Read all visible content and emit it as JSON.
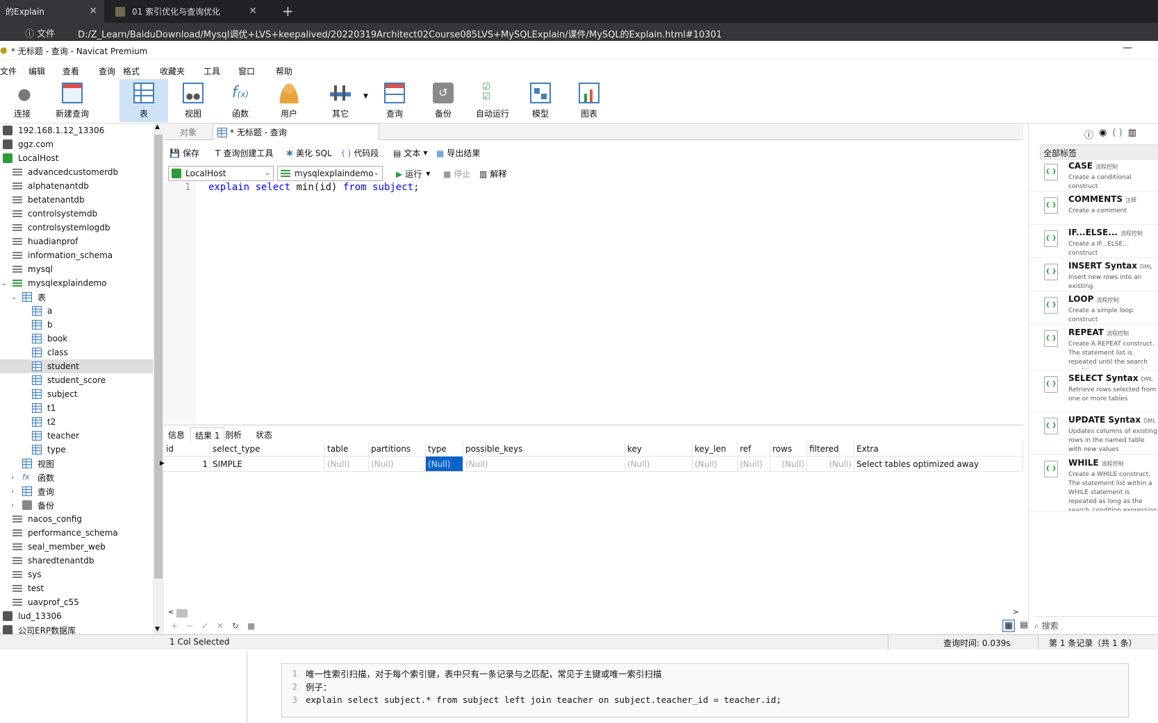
{
  "browser": {
    "tabs": [
      {
        "label": "的Explain",
        "active": true
      },
      {
        "label": "01 索引优化与查询优化",
        "active": false
      }
    ],
    "info_label": "文件",
    "url": "D:/Z_Learn/BaiduDownload/Mysql调优+LVS+keepalived/20220319Architect02Course085LVS+MySQLExplain/课件/MySQL的Explain.html#10301"
  },
  "window": {
    "title": "* 无标题 - 查询 - Navicat Premium"
  },
  "menu": [
    "文件",
    "编辑",
    "查看",
    "查询",
    "格式",
    "收藏夹",
    "工具",
    "窗口",
    "帮助"
  ],
  "toolbar": [
    {
      "label": "连接",
      "icon": "plug-icon"
    },
    {
      "label": "新建查询",
      "icon": "new-query-icon"
    },
    {
      "label": "表",
      "icon": "table-icon",
      "active": true
    },
    {
      "label": "视图",
      "icon": "view-icon"
    },
    {
      "label": "函数",
      "icon": "function-icon"
    },
    {
      "label": "用户",
      "icon": "user-icon"
    },
    {
      "label": "其它",
      "icon": "tools-icon"
    },
    {
      "label": "查询",
      "icon": "query-icon"
    },
    {
      "label": "备份",
      "icon": "backup-icon"
    },
    {
      "label": "自动运行",
      "icon": "schedule-icon"
    },
    {
      "label": "模型",
      "icon": "model-icon"
    },
    {
      "label": "图表",
      "icon": "chart-icon"
    }
  ],
  "tree": [
    {
      "label": "192.168.1.12_13306",
      "kind": "conn",
      "indent": 0
    },
    {
      "label": "ggz.com",
      "kind": "conn",
      "indent": 0
    },
    {
      "label": "LocalHost",
      "kind": "conn-green",
      "indent": 0
    },
    {
      "label": "advancedcustomerdb",
      "kind": "db",
      "indent": 1
    },
    {
      "label": "alphatenantdb",
      "kind": "db",
      "indent": 1
    },
    {
      "label": "betatenantdb",
      "kind": "db",
      "indent": 1
    },
    {
      "label": "controlsystemdb",
      "kind": "db",
      "indent": 1
    },
    {
      "label": "controlsystemlogdb",
      "kind": "db",
      "indent": 1
    },
    {
      "label": "huadianprof",
      "kind": "db",
      "indent": 1
    },
    {
      "label": "information_schema",
      "kind": "db",
      "indent": 1
    },
    {
      "label": "mysql",
      "kind": "db",
      "indent": 1
    },
    {
      "label": "mysqlexplaindemo",
      "kind": "db-green",
      "indent": 1,
      "expander": "v"
    },
    {
      "label": "表",
      "kind": "tbl",
      "indent": 2,
      "expander": "v"
    },
    {
      "label": "a",
      "kind": "tbl",
      "indent": 3
    },
    {
      "label": "b",
      "kind": "tbl",
      "indent": 3
    },
    {
      "label": "book",
      "kind": "tbl",
      "indent": 3
    },
    {
      "label": "class",
      "kind": "tbl",
      "indent": 3
    },
    {
      "label": "student",
      "kind": "tbl",
      "indent": 3,
      "selected": true
    },
    {
      "label": "student_score",
      "kind": "tbl",
      "indent": 3
    },
    {
      "label": "subject",
      "kind": "tbl",
      "indent": 3
    },
    {
      "label": "t1",
      "kind": "tbl",
      "indent": 3
    },
    {
      "label": "t2",
      "kind": "tbl",
      "indent": 3
    },
    {
      "label": "teacher",
      "kind": "tbl",
      "indent": 3
    },
    {
      "label": "type",
      "kind": "tbl",
      "indent": 3
    },
    {
      "label": "视图",
      "kind": "tbl",
      "indent": 2
    },
    {
      "label": "函数",
      "kind": "fx",
      "indent": 2,
      "expander": ">"
    },
    {
      "label": "查询",
      "kind": "tbl",
      "indent": 2,
      "expander": ">"
    },
    {
      "label": "备份",
      "kind": "backup",
      "indent": 2,
      "expander": ">"
    },
    {
      "label": "nacos_config",
      "kind": "db",
      "indent": 1
    },
    {
      "label": "performance_schema",
      "kind": "db",
      "indent": 1
    },
    {
      "label": "seal_member_web",
      "kind": "db",
      "indent": 1
    },
    {
      "label": "sharedtenantdb",
      "kind": "db",
      "indent": 1
    },
    {
      "label": "sys",
      "kind": "db",
      "indent": 1
    },
    {
      "label": "test",
      "kind": "db",
      "indent": 1
    },
    {
      "label": "uavprof_c55",
      "kind": "db",
      "indent": 1
    },
    {
      "label": "lud_13306",
      "kind": "conn",
      "indent": 0
    },
    {
      "label": "公司ERP数据库",
      "kind": "conn",
      "indent": 0
    }
  ],
  "objtabs": {
    "objects": "对象",
    "query": "* 无标题 - 查询"
  },
  "qtools": {
    "save": "保存",
    "builder": "查询创建工具",
    "beautify": "美化 SQL",
    "snippet": "代码段",
    "text": "文本",
    "export": "导出结果"
  },
  "connrow": {
    "connection": "LocalHost",
    "database": "mysqlexplaindemo",
    "run": "运行",
    "stop": "停止",
    "explain": "解释"
  },
  "editor": {
    "line_no": "1",
    "tokens": [
      {
        "t": "explain",
        "c": "kw"
      },
      {
        "t": " ",
        "c": ""
      },
      {
        "t": "select",
        "c": "kw"
      },
      {
        "t": " min(id) ",
        "c": ""
      },
      {
        "t": "from",
        "c": "kw"
      },
      {
        "t": " ",
        "c": ""
      },
      {
        "t": "subject",
        "c": "kw"
      },
      {
        "t": ";",
        "c": ""
      }
    ]
  },
  "result_tabs": [
    {
      "label": "信息",
      "active": false
    },
    {
      "label": "结果 1",
      "active": true
    },
    {
      "label": "剖析",
      "active": false
    },
    {
      "label": "状态",
      "active": false
    }
  ],
  "grid": {
    "columns": [
      "id",
      "select_type",
      "table",
      "partitions",
      "type",
      "possible_keys",
      "key",
      "key_len",
      "ref",
      "rows",
      "filtered",
      "Extra"
    ],
    "rows": [
      [
        "1",
        "SIMPLE",
        "(Null)",
        "(Null)",
        "(Null)",
        "(Null)",
        "(Null)",
        "(Null)",
        "(Null)",
        "(Null)",
        "(Null)",
        "Select tables optimized away"
      ]
    ]
  },
  "status": {
    "selection": "1 Col Selected",
    "query_time": "查询时间: 0.039s",
    "records": "第 1 条记录（共 1 条）"
  },
  "right_panel": {
    "filter": "全部标签",
    "search_placeholder": "搜索",
    "snippets": [
      {
        "title": "CASE",
        "tag": "流程控制",
        "desc": "Create a conditional construct"
      },
      {
        "title": "COMMENTS",
        "tag": "注释",
        "desc": "Create a comment"
      },
      {
        "title": "IF...ELSE...",
        "tag": "流程控制",
        "desc": "Create a IF...ELSE... construct"
      },
      {
        "title": "INSERT Syntax",
        "tag": "DML",
        "desc": "Insert new rows into an existing"
      },
      {
        "title": "LOOP",
        "tag": "流程控制",
        "desc": "Create a simple loop construct"
      },
      {
        "title": "REPEAT",
        "tag": "流程控制",
        "desc": "Create A REPEAT construct. The statement list is repeated until the search condition expression is true."
      },
      {
        "title": "SELECT Syntax",
        "tag": "DML",
        "desc": "Retrieve rows selected from one or more tables"
      },
      {
        "title": "UPDATE Syntax",
        "tag": "DML",
        "desc": "Updates columns of existing rows in the named table with new values"
      },
      {
        "title": "WHILE",
        "tag": "流程控制",
        "desc": "Create a WHILE construct. The statement list within a WHILE statement is repeated as long as the search_condition expression is true."
      }
    ]
  },
  "page_code": {
    "lines": [
      {
        "n": "1",
        "text": "唯一性索引扫描，对于每个索引键，表中只有一条记录与之匹配，常见于主键或唯一索引扫描"
      },
      {
        "n": "2",
        "text": "例子："
      },
      {
        "n": "3",
        "text": "explain select subject.* from subject left join teacher on subject.teacher_id = teacher.id;"
      }
    ]
  }
}
